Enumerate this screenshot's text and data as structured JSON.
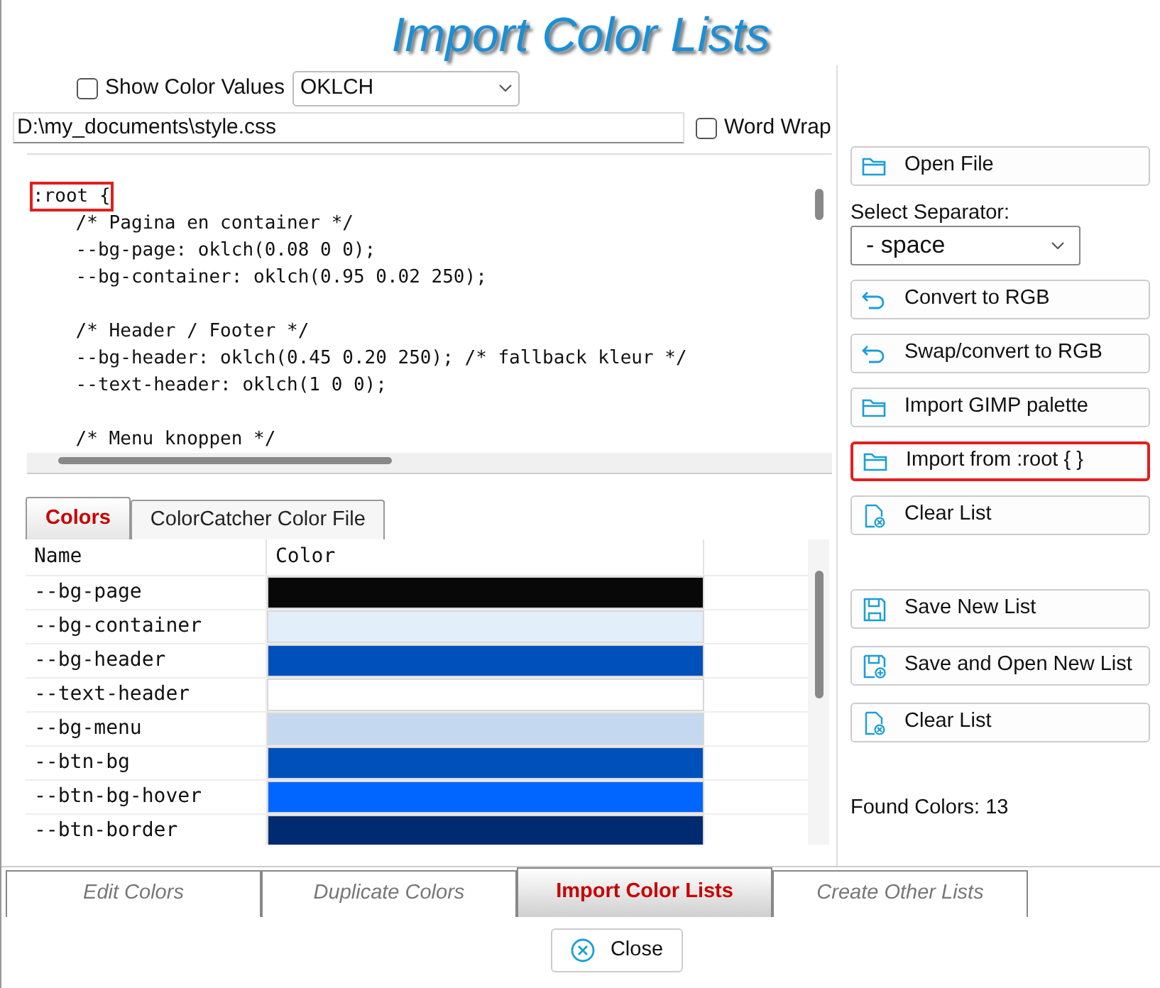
{
  "window": {
    "title": "Import Color Lists"
  },
  "show_color_values": {
    "label": "Show Color Values",
    "checked": false,
    "format": "OKLCH"
  },
  "file_path": {
    "value": "D:\\my_documents\\style.css"
  },
  "word_wrap": {
    "label": "Word Wrap",
    "checked": false
  },
  "code": [
    {
      "kind": "text",
      "text": ":root {",
      "highlighted": true
    },
    {
      "kind": "text",
      "text": "    /* Pagina en container */",
      "highlighted": false
    },
    {
      "kind": "text",
      "text": "    --bg-page: oklch(0.08 0 0);",
      "highlighted": false
    },
    {
      "kind": "text",
      "text": "    --bg-container: oklch(0.95 0.02 250);",
      "highlighted": false
    },
    {
      "kind": "blank"
    },
    {
      "kind": "text",
      "text": "    /* Header / Footer */",
      "highlighted": false
    },
    {
      "kind": "text",
      "text": "    --bg-header: oklch(0.45 0.20 250); /* fallback kleur */",
      "highlighted": false
    },
    {
      "kind": "text",
      "text": "    --text-header: oklch(1 0 0);",
      "highlighted": false
    },
    {
      "kind": "blank"
    },
    {
      "kind": "text",
      "text": "    /* Menu knoppen */",
      "highlighted": false
    }
  ],
  "list_tabs": [
    {
      "label": "Colors",
      "selected": true
    },
    {
      "label": "ColorCatcher Color File",
      "selected": false
    }
  ],
  "table": {
    "columns": [
      "Name",
      "Color"
    ],
    "rows": [
      {
        "name": "--bg-page",
        "color": "#080808"
      },
      {
        "name": "--bg-container",
        "color": "#e2eefa"
      },
      {
        "name": "--bg-header",
        "color": "#0050bc"
      },
      {
        "name": "--text-header",
        "color": "#ffffff"
      },
      {
        "name": "--bg-menu",
        "color": "#c4d9f0"
      },
      {
        "name": "--btn-bg",
        "color": "#0050bc"
      },
      {
        "name": "--btn-bg-hover",
        "color": "#0066ff"
      },
      {
        "name": "--btn-border",
        "color": "#002b70"
      }
    ]
  },
  "open_button": {
    "label": "Open File",
    "kind": "folder"
  },
  "separator": {
    "label": "Select Separator:",
    "value": "- space"
  },
  "buttons": [
    {
      "label": "Convert to RGB",
      "kind": "undo",
      "highlighted": false
    },
    {
      "label": "Swap/convert to RGB",
      "kind": "undo",
      "highlighted": false
    },
    {
      "label": "Import GIMP palette",
      "kind": "folder",
      "highlighted": false
    },
    {
      "label": "Import from :root { }",
      "kind": "folder",
      "highlighted": true
    },
    {
      "label": "Clear List",
      "kind": "clear",
      "highlighted": false
    }
  ],
  "list_buttons": [
    {
      "label": "Save New List",
      "kind": "save"
    },
    {
      "label": "Save and Open New List",
      "kind": "saveplus"
    },
    {
      "label": "Clear List",
      "kind": "clear"
    }
  ],
  "found_colors": "Found Colors: 13",
  "bottom_tabs": [
    {
      "label": "Edit Colors",
      "selected": false
    },
    {
      "label": "Duplicate Colors",
      "selected": false
    },
    {
      "label": "Import Color Lists",
      "selected": true
    },
    {
      "label": "Create Other Lists",
      "selected": false
    }
  ],
  "close_button": {
    "label": "Close"
  }
}
